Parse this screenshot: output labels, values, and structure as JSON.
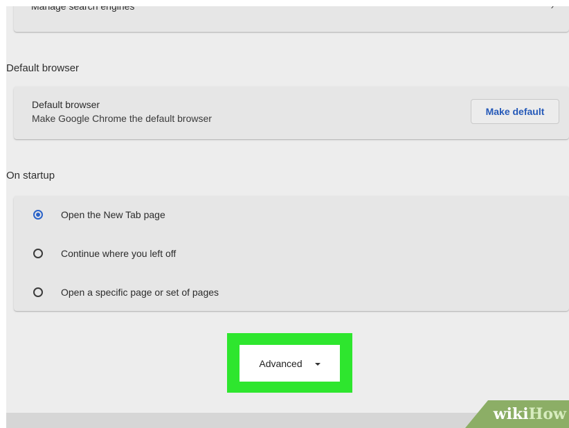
{
  "search": {
    "manage_engines_label": "Manage search engines",
    "chevron": "›"
  },
  "default_browser": {
    "section_title": "Default browser",
    "row_title": "Default browser",
    "row_subtitle": "Make Google Chrome the default browser",
    "button_label": "Make default"
  },
  "on_startup": {
    "section_title": "On startup",
    "options": [
      {
        "label": "Open the New Tab page",
        "selected": true
      },
      {
        "label": "Continue where you left off",
        "selected": false
      },
      {
        "label": "Open a specific page or set of pages",
        "selected": false
      }
    ]
  },
  "advanced": {
    "label": "Advanced",
    "icon": "caret-down-icon"
  },
  "watermark": {
    "wiki": "wiki",
    "how": "How"
  },
  "colors": {
    "accent_blue": "#2a63c9",
    "highlight_green": "#2ee62e",
    "card_bg": "#e6e6e6",
    "page_bg": "#ededed"
  }
}
